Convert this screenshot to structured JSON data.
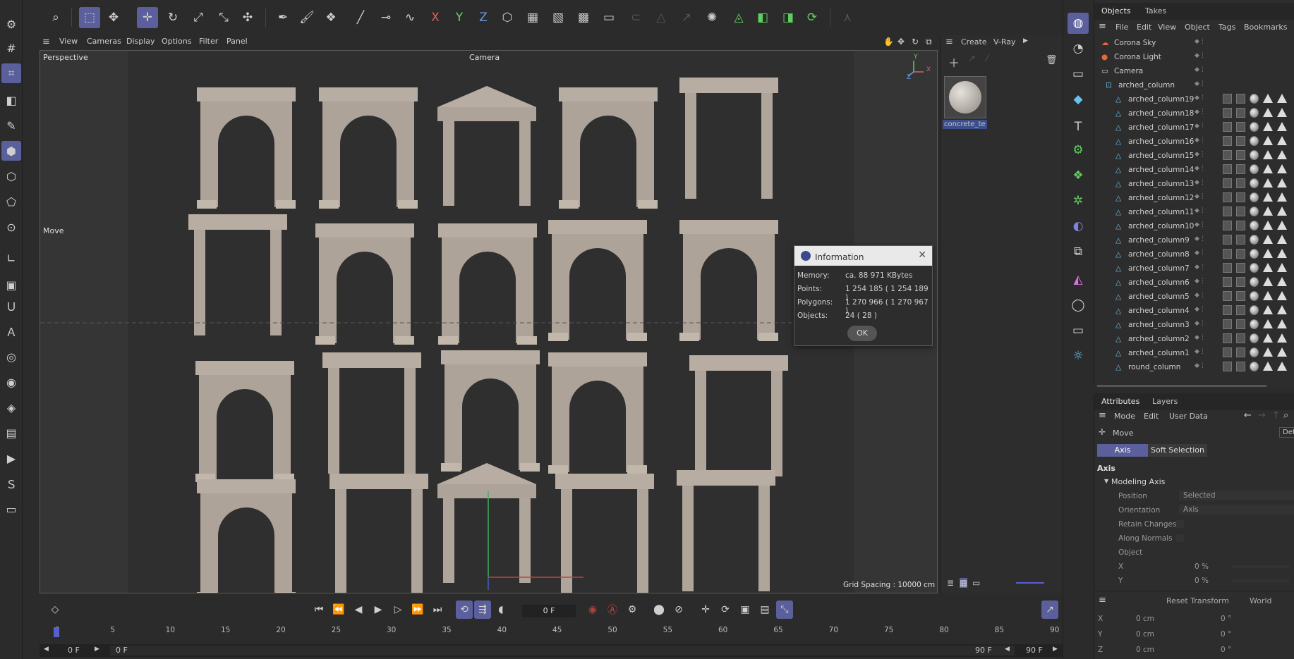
{
  "top_toolbar": {
    "icons": [
      "search-icon",
      "selection-icon",
      "live-select-icon",
      "move-icon",
      "rotate-icon",
      "scale-icon",
      "axis-move-icon",
      "transform-icon",
      "pen-icon",
      "brush-icon",
      "cloner-icon",
      "paint-icon",
      "knife-icon",
      "bend-icon",
      "x-axis-icon",
      "y-axis-icon",
      "z-axis-icon",
      "coordinate-icon",
      "render-view-icon",
      "render-icon",
      "render-settings-icon",
      "picture-viewer-icon",
      "lock-icon",
      "pyramid-icon",
      "arrow-icon",
      "particle-icon",
      "triangle-icon",
      "cube-icon",
      "cube2-icon",
      "plugin-icon",
      "person-icon"
    ]
  },
  "viewport_menu": {
    "items": [
      "View",
      "Cameras",
      "Display",
      "Options",
      "Filter",
      "Panel"
    ]
  },
  "viewport": {
    "view_name": "Perspective",
    "camera_label": "Camera",
    "tool_label": "Move",
    "grid_spacing": "Grid Spacing : 10000 cm",
    "axis_x": "X",
    "axis_y": "Y",
    "axis_z": "Z"
  },
  "info_dialog": {
    "title": "Information",
    "rows": [
      {
        "label": "Memory:",
        "value": "ca. 88 971 KBytes"
      },
      {
        "label": "Points:",
        "value": "1 254 185 ( 1 254 189 )"
      },
      {
        "label": "Polygons:",
        "value": "1 270 966 ( 1 270 967 )"
      },
      {
        "label": "Objects:",
        "value": "24 ( 28 )"
      }
    ],
    "ok": "OK"
  },
  "material_panel": {
    "menu": [
      "Create",
      "V-Ray"
    ],
    "material_name": "concrete_te"
  },
  "object_manager": {
    "tabs": [
      "Objects",
      "Takes"
    ],
    "menu": [
      "File",
      "Edit",
      "View",
      "Object",
      "Tags",
      "Bookmarks"
    ],
    "rows": [
      {
        "name": "Corona Sky",
        "kind": "sky"
      },
      {
        "name": "Corona Light",
        "kind": "light"
      },
      {
        "name": "Camera",
        "kind": "camera"
      },
      {
        "name": "arched_column",
        "kind": "group"
      },
      {
        "name": "arched_column19",
        "kind": "child"
      },
      {
        "name": "arched_column18",
        "kind": "child"
      },
      {
        "name": "arched_column17",
        "kind": "child"
      },
      {
        "name": "arched_column16",
        "kind": "child"
      },
      {
        "name": "arched_column15",
        "kind": "child"
      },
      {
        "name": "arched_column14",
        "kind": "child"
      },
      {
        "name": "arched_column13",
        "kind": "child"
      },
      {
        "name": "arched_column12",
        "kind": "child"
      },
      {
        "name": "arched_column11",
        "kind": "child"
      },
      {
        "name": "arched_column10",
        "kind": "child"
      },
      {
        "name": "arched_column9",
        "kind": "child"
      },
      {
        "name": "arched_column8",
        "kind": "child"
      },
      {
        "name": "arched_column7",
        "kind": "child"
      },
      {
        "name": "arched_column6",
        "kind": "child"
      },
      {
        "name": "arched_column5",
        "kind": "child"
      },
      {
        "name": "arched_column4",
        "kind": "child"
      },
      {
        "name": "arched_column3",
        "kind": "child"
      },
      {
        "name": "arched_column2",
        "kind": "child"
      },
      {
        "name": "arched_column1",
        "kind": "child"
      },
      {
        "name": "round_column",
        "kind": "child"
      }
    ]
  },
  "attributes": {
    "tabs": [
      "Attributes",
      "Layers"
    ],
    "menu": [
      "Mode",
      "Edit",
      "User Data"
    ],
    "tool": "Move",
    "sub_tabs": [
      "Axis",
      "Soft Selection"
    ],
    "section": "Axis",
    "group": "Modeling Axis",
    "fields": [
      {
        "label": "Position",
        "value": "Selected"
      },
      {
        "label": "Orientation",
        "value": "Axis"
      },
      {
        "label": "Retain Changes",
        "value": ""
      },
      {
        "label": "Along Normals",
        "value": ""
      },
      {
        "label": "Object",
        "value": ""
      },
      {
        "label": "X",
        "value": "0 %"
      },
      {
        "label": "Y",
        "value": "0 %"
      }
    ],
    "reset": "Reset Transform",
    "space": "World",
    "cut": "Def",
    "coords": [
      {
        "axis": "X",
        "pos": "0 cm",
        "rot": "0 °"
      },
      {
        "axis": "Y",
        "pos": "0 cm",
        "rot": "0 °"
      },
      {
        "axis": "Z",
        "pos": "0 cm",
        "rot": "0 °"
      }
    ]
  },
  "timeline": {
    "current_frame": "0 F",
    "start": "0 F",
    "start2": "0 F",
    "end": "90 F",
    "end2": "90 F",
    "ticks": [
      "0",
      "5",
      "10",
      "15",
      "20",
      "25",
      "30",
      "35",
      "40",
      "45",
      "50",
      "55",
      "60",
      "65",
      "70",
      "75",
      "80",
      "85",
      "90"
    ]
  }
}
